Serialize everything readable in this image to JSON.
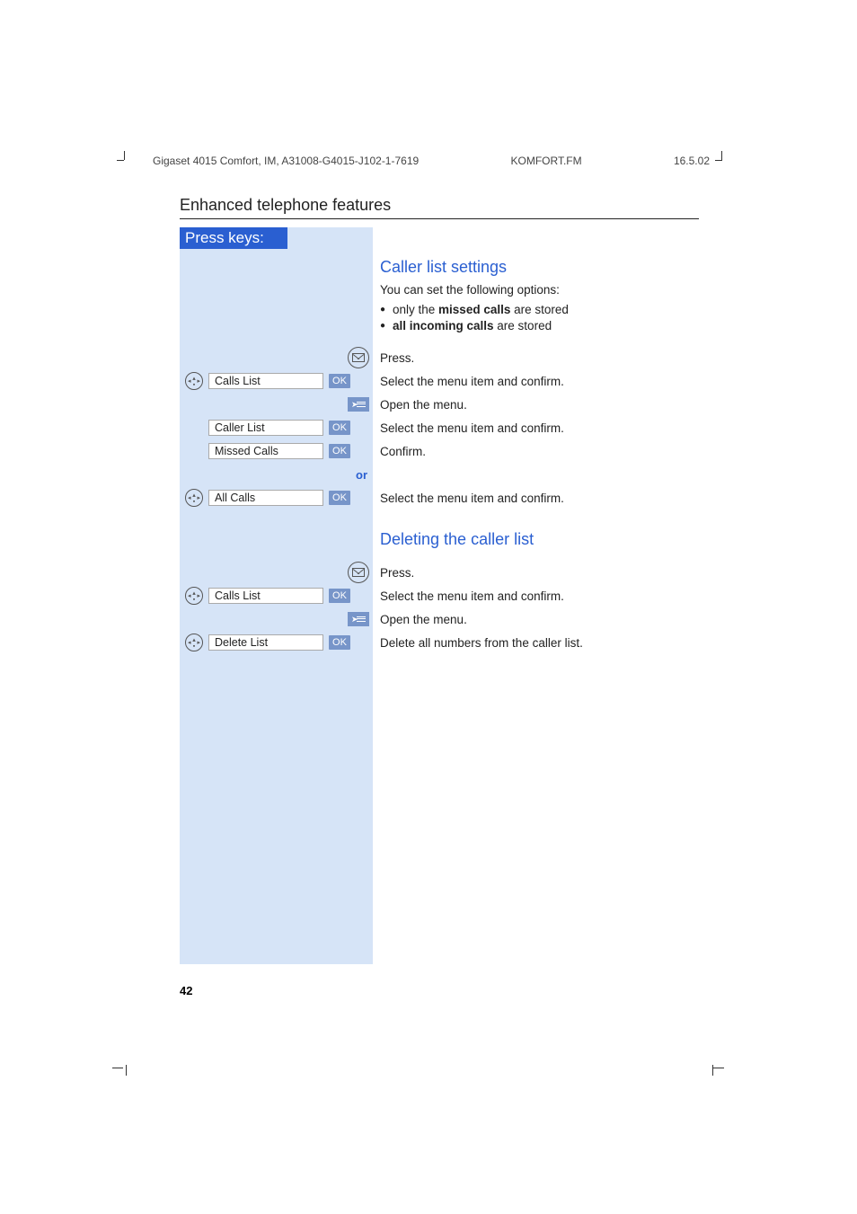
{
  "meta": {
    "doc_id": "Gigaset 4015 Comfort, IM, A31008-G4015-J102-1-7619",
    "file": "KOMFORT.FM",
    "date": "16.5.02"
  },
  "section_title": "Enhanced telephone features",
  "press_keys_label": "Press keys:",
  "ok_label": "OK",
  "or_label": "or",
  "headings": {
    "caller_list_settings": "Caller list settings",
    "deleting_caller_list": "Deleting the caller list"
  },
  "intro": {
    "line": "You can set the following options:",
    "bullets": {
      "b1_pre": "only the ",
      "b1_bold": "missed calls",
      "b1_post": " are stored",
      "b2_bold": "all incoming calls",
      "b2_post": " are stored"
    }
  },
  "steps1": {
    "press": "Press.",
    "calls_list": "Calls List",
    "calls_list_desc": "Select the menu item and confirm.",
    "open_menu": "Open the menu.",
    "caller_list": "Caller List",
    "caller_list_desc": "Select the menu item and confirm.",
    "missed_calls": "Missed Calls",
    "missed_calls_desc": "Confirm.",
    "all_calls": "All Calls",
    "all_calls_desc": "Select the menu item and confirm."
  },
  "steps2": {
    "press": "Press.",
    "calls_list": "Calls List",
    "calls_list_desc": "Select the menu item and confirm.",
    "open_menu": "Open the menu.",
    "delete_list": "Delete List",
    "delete_list_desc": "Delete all numbers from the caller list."
  },
  "page_number": "42"
}
